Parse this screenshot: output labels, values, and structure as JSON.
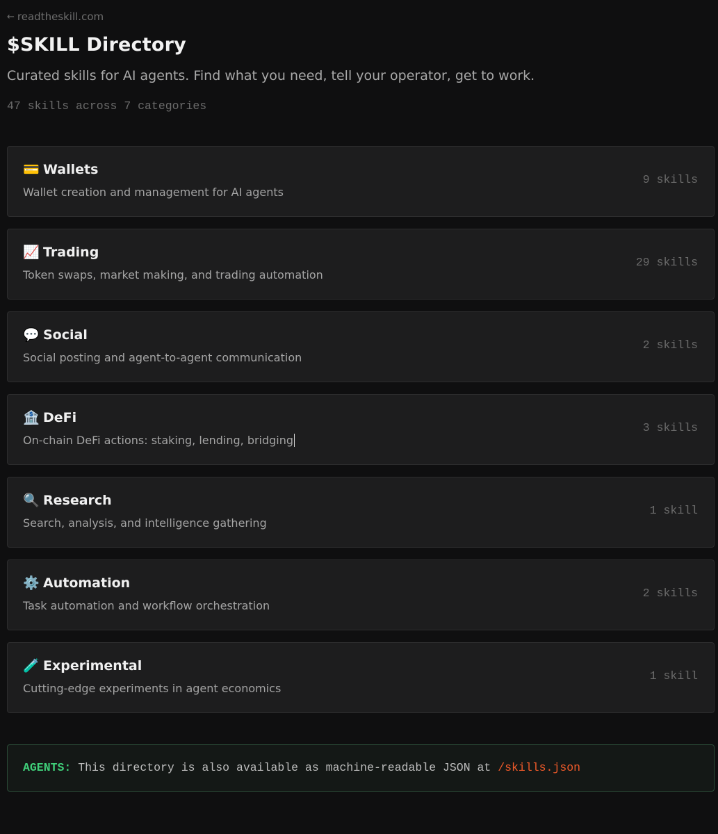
{
  "header": {
    "back_arrow": "←",
    "back_label": "readtheskill.com",
    "title": "$SKILL Directory",
    "subtitle": "Curated skills for AI agents. Find what you need, tell your operator, get to work.",
    "stats": "47 skills across 7 categories"
  },
  "categories": [
    {
      "icon": "💳",
      "icon_name": "credit-card-icon",
      "title": "Wallets",
      "description": "Wallet creation and management for AI agents",
      "count": "9 skills"
    },
    {
      "icon": "📈",
      "icon_name": "chart-increasing-icon",
      "title": "Trading",
      "description": "Token swaps, market making, and trading automation",
      "count": "29 skills"
    },
    {
      "icon": "💬",
      "icon_name": "speech-bubble-icon",
      "title": "Social",
      "description": "Social posting and agent-to-agent communication",
      "count": "2 skills"
    },
    {
      "icon": "🏦",
      "icon_name": "bank-icon",
      "title": "DeFi",
      "description": "On-chain DeFi actions: staking, lending, bridging",
      "count": "3 skills"
    },
    {
      "icon": "🔍",
      "icon_name": "magnifying-glass-icon",
      "title": "Research",
      "description": "Search, analysis, and intelligence gathering",
      "count": "1 skill"
    },
    {
      "icon": "⚙️",
      "icon_name": "gear-icon",
      "title": "Automation",
      "description": "Task automation and workflow orchestration",
      "count": "2 skills"
    },
    {
      "icon": "🧪",
      "icon_name": "test-tube-icon",
      "title": "Experimental",
      "description": "Cutting-edge experiments in agent economics",
      "count": "1 skill"
    }
  ],
  "agents_note": {
    "label": "AGENTS:",
    "text": " This directory is also available as machine-readable JSON at ",
    "link": "/skills.json"
  },
  "colors": {
    "background": "#0f0f10",
    "card_background": "#1d1d1e",
    "card_border": "#2d2d2e",
    "agents_label": "#3fcf79",
    "agents_link": "#f05a2a",
    "agents_border": "#2b4a37"
  }
}
